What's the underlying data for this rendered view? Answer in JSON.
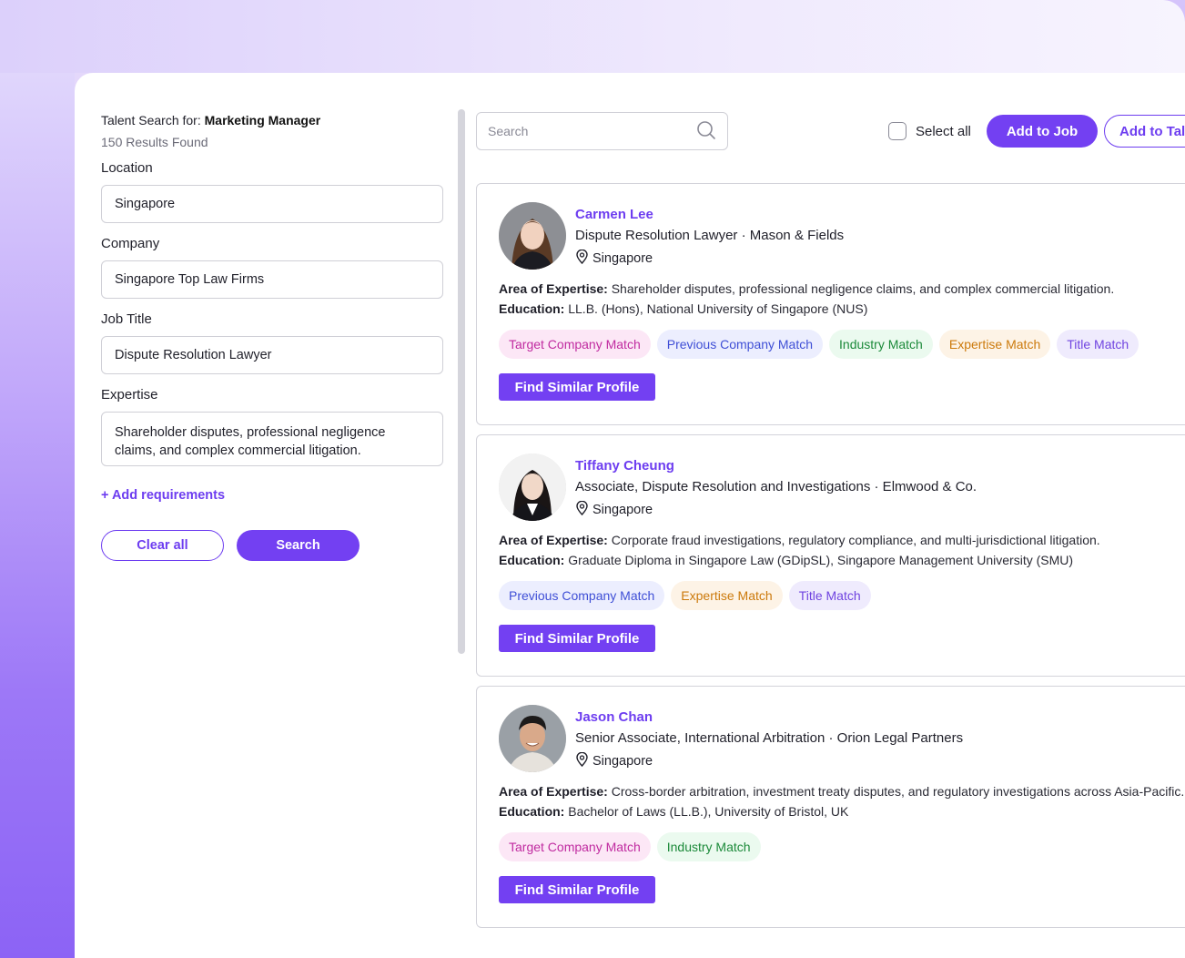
{
  "filters": {
    "search_for_prefix": "Talent Search for:",
    "search_for_value": "Marketing Manager",
    "results": "150 Results Found",
    "location_label": "Location",
    "location_value": "Singapore",
    "company_label": "Company",
    "company_value": "Singapore Top Law Firms",
    "job_title_label": "Job Title",
    "job_title_value": "Dispute Resolution Lawyer",
    "expertise_label": "Expertise",
    "expertise_value": "Shareholder disputes, professional negligence claims, and complex commercial litigation.",
    "add_requirements": "+ Add requirements",
    "clear_all": "Clear all",
    "search": "Search"
  },
  "toolbar": {
    "search_placeholder": "Search",
    "select_all": "Select all",
    "add_to_job": "Add to Job",
    "add_to_talent": "Add to Tale"
  },
  "profiles": [
    {
      "name": "Carmen Lee",
      "role": "Dispute Resolution Lawyer · Mason & Fields",
      "location": "Singapore",
      "expertise_label": "Area of Expertise:",
      "expertise": "Shareholder disputes, professional negligence claims, and complex commercial litigation.",
      "education_label": "Education:",
      "education": "LL.B. (Hons), National University of Singapore (NUS)",
      "tags": [
        "Target Company Match",
        "Previous Company Match",
        "Industry Match",
        "Expertise Match",
        "Title Match"
      ],
      "action": "Find Similar Profile"
    },
    {
      "name": "Tiffany Cheung",
      "role": "Associate, Dispute Resolution and Investigations · Elmwood & Co.",
      "location": "Singapore",
      "expertise_label": "Area of Expertise:",
      "expertise": "Corporate fraud investigations, regulatory compliance, and multi-jurisdictional litigation.",
      "education_label": "Education:",
      "education": "Graduate Diploma in Singapore Law (GDipSL), Singapore Management University (SMU)",
      "tags": [
        "Previous Company Match",
        "Expertise Match",
        "Title Match"
      ],
      "action": "Find Similar Profile"
    },
    {
      "name": "Jason Chan",
      "role": "Senior Associate, International Arbitration · Orion Legal Partners",
      "location": "Singapore",
      "expertise_label": "Area of Expertise:",
      "expertise": "Cross-border arbitration, investment treaty disputes, and regulatory investigations across Asia-Pacific.",
      "education_label": "Education:",
      "education": "Bachelor of Laws (LL.B.), University of Bristol, UK",
      "tags": [
        "Target Company Match",
        "Industry Match"
      ],
      "action": "Find Similar Profile"
    }
  ],
  "colors": {
    "accent": "#7340f2",
    "name": "#6d3df0"
  }
}
